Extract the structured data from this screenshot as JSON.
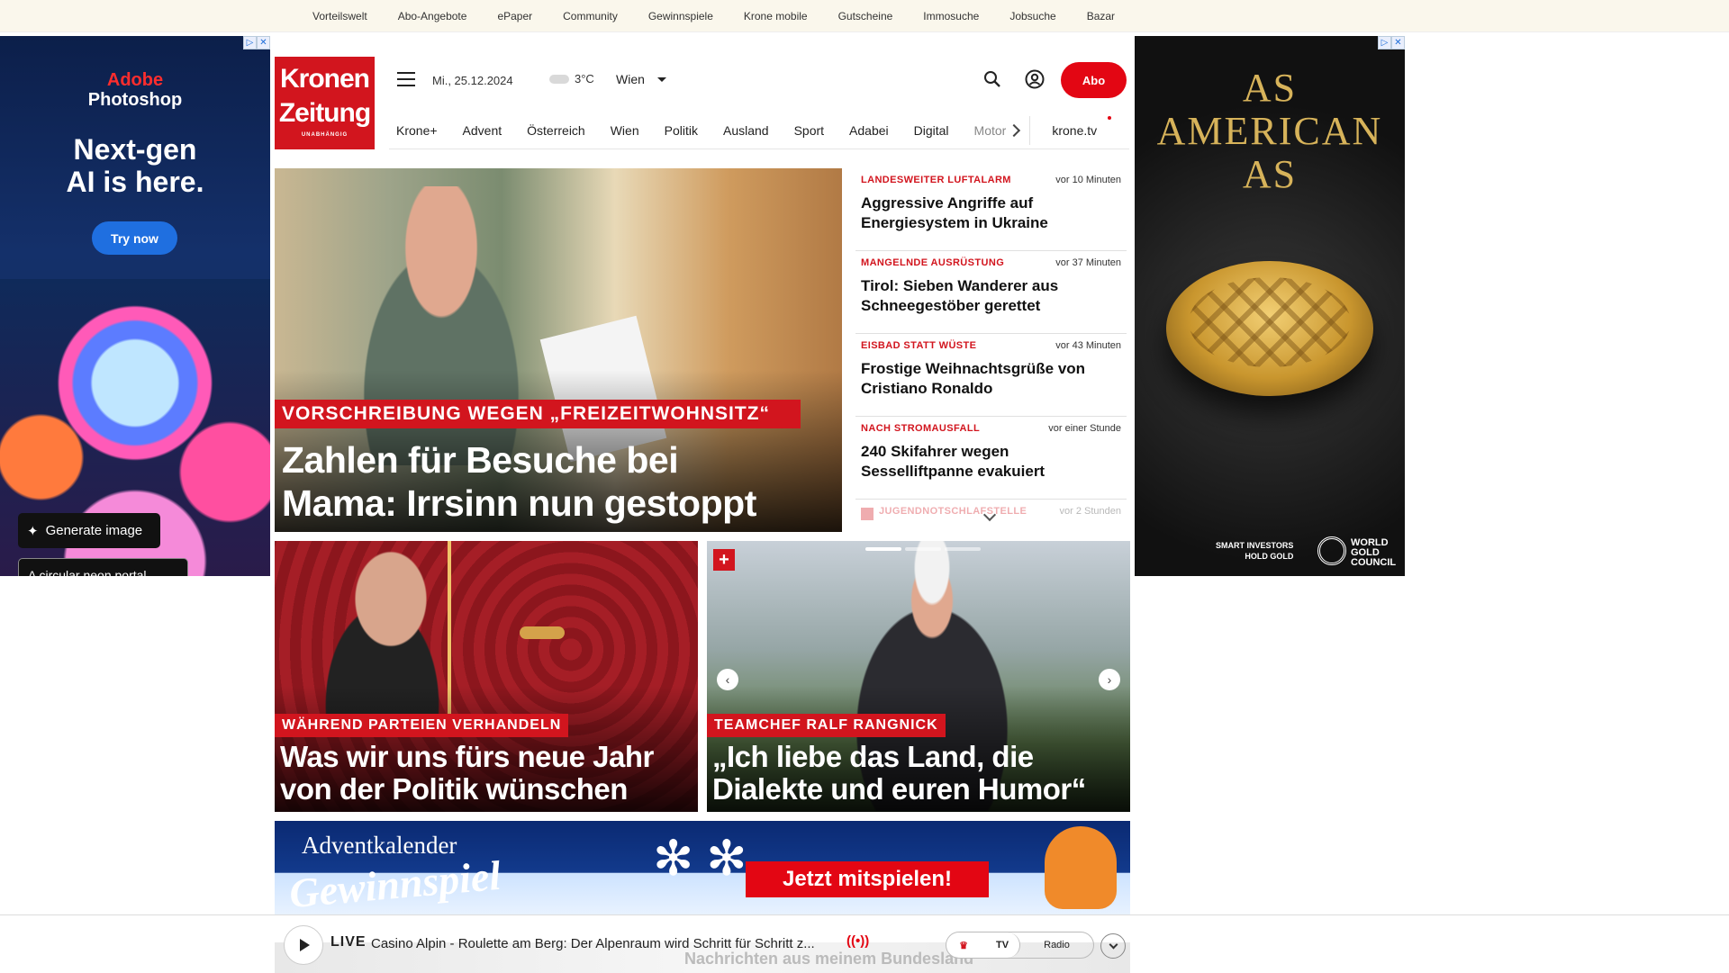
{
  "topbar": {
    "links": [
      "Vorteilswelt",
      "Abo-Angebote",
      "ePaper",
      "Community",
      "Gewinnspiele",
      "Krone mobile",
      "Gutscheine",
      "Immosuche",
      "Jobsuche",
      "Bazar"
    ]
  },
  "ad_left": {
    "brand_line1": "Adobe",
    "brand_line2": "Photoshop",
    "headline_line1": "Next-gen",
    "headline_line2": "AI is here.",
    "cta": "Try now",
    "generate_label": "Generate image",
    "prompt_text": "A circular neon portal ..."
  },
  "ad_right": {
    "tagline_line1": "AS",
    "tagline_line2": "AMERICAN",
    "tagline_line3": "AS",
    "footer_line1": "SMART INVESTORS",
    "footer_line2": "HOLD GOLD",
    "wgc_line1": "WORLD",
    "wgc_line2": "GOLD",
    "wgc_line3": "COUNCIL"
  },
  "header": {
    "logo_line1": "Kronen",
    "logo_line2": "Zeitung",
    "logo_sub": "UNABHÄNGIG",
    "date": "Mi., 25.12.2024",
    "temperature": "3°C",
    "city": "Wien",
    "abo_label": "Abo"
  },
  "nav": {
    "items": [
      "Krone+",
      "Advent",
      "Österreich",
      "Wien",
      "Politik",
      "Ausland",
      "Sport",
      "Adabei",
      "Digital"
    ],
    "faded_item": "Motor",
    "tv": "krone.tv"
  },
  "hero": {
    "kicker": "VORSCHREIBUNG WEGEN „FREIZEITWOHNSITZ“",
    "title_line1": "Zahlen für Besuche bei",
    "title_line2": "Mama: Irrsinn nun gestoppt"
  },
  "news": [
    {
      "kicker": "LANDESWEITER LUFTALARM",
      "time": "vor 10 Minuten",
      "headline": "Aggressive Angriffe auf Energiesystem in Ukraine"
    },
    {
      "kicker": "MANGELNDE AUSRÜSTUNG",
      "time": "vor 37 Minuten",
      "headline": "Tirol: Sieben Wanderer aus Schneegestöber gerettet"
    },
    {
      "kicker": "EISBAD STATT WÜSTE",
      "time": "vor 43 Minuten",
      "headline": "Frostige Weihnachtsgrüße von Cristiano Ronaldo"
    },
    {
      "kicker": "NACH STROMAUSFALL",
      "time": "vor einer Stunde",
      "headline": "240 Skifahrer wegen Sesselliftpanne evakuiert"
    },
    {
      "kicker": "JUGENDNOTSCHLAFSTELLE",
      "time": "vor 2 Stunden",
      "headline": ""
    }
  ],
  "cards": [
    {
      "kicker": "WÄHREND PARTEIEN VERHANDELN",
      "title_line1": "Was wir uns fürs neue Jahr",
      "title_line2": "von der Politik wünschen"
    },
    {
      "kicker": "TEAMCHEF RALF RANGNICK",
      "title_line1": "„Ich liebe das Land, die",
      "title_line2": "Dialekte und euren Humor“"
    }
  ],
  "advent": {
    "line1": "Adventkalender",
    "line2": "Gewinnspiel",
    "cta": "Jetzt mitspielen!"
  },
  "player": {
    "live_label": "LIVE",
    "title": "Casino Alpin - Roulette am Berg: Der Alpenraum wird Schritt für Schritt z...",
    "tv_label": "TV",
    "radio_label": "Radio",
    "behind_text": "Nachrichten aus meinem Bundesland"
  },
  "colors": {
    "brand_red": "#d2151e",
    "abo_red": "#e30613",
    "topbar_bg": "#faf7ec"
  }
}
